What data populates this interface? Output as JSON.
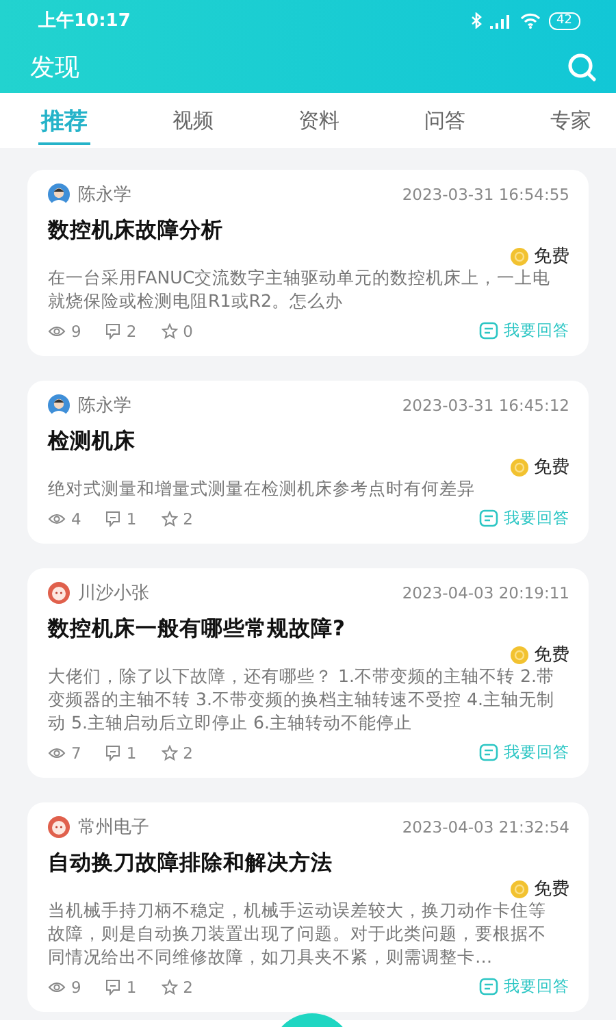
{
  "status_bar": {
    "time": "上午10:17",
    "battery": "42"
  },
  "header": {
    "title": "发现"
  },
  "tabs": [
    {
      "label": "推荐",
      "selected": true
    },
    {
      "label": "视频",
      "selected": false
    },
    {
      "label": "资料",
      "selected": false
    },
    {
      "label": "问答",
      "selected": false
    },
    {
      "label": "专家",
      "selected": false
    }
  ],
  "posts": [
    {
      "kind": "person",
      "author": "陈永学",
      "time": "2023-03-31 16:54:55",
      "title": "数控机床故障分析",
      "price": "免费",
      "description": "在一台采用FANUC交流数字主轴驱动单元的数控机床上，一上电就烧保险或检测电阻R1或R2。怎么办",
      "views": "9",
      "comments": "2",
      "favorites": "0",
      "answer": "我要回答"
    },
    {
      "kind": "person",
      "author": "陈永学",
      "time": "2023-03-31 16:45:12",
      "title": "检测机床",
      "price": "免费",
      "description": "绝对式测量和增量式测量在检测机床参考点时有何差异",
      "views": "4",
      "comments": "1",
      "favorites": "2",
      "answer": "我要回答"
    },
    {
      "kind": "face",
      "author": "川沙小张",
      "time": "2023-04-03 20:19:11",
      "title": "数控机床一般有哪些常规故障?",
      "price": "免费",
      "description": "大佬们，除了以下故障，还有哪些？ 1.不带变频的主轴不转 2.带变频器的主轴不转 3.不带变频的换档主轴转速不受控 4.主轴无制动 5.主轴启动后立即停止 6.主轴转动不能停止",
      "views": "7",
      "comments": "1",
      "favorites": "2",
      "answer": "我要回答"
    },
    {
      "kind": "face",
      "author": "常州电子",
      "time": "2023-04-03 21:32:54",
      "title": "自动换刀故障排除和解决方法",
      "price": "免费",
      "description": "当机械手持刀柄不稳定，机械手运动误差较大，换刀动作卡住等故障，则是自动换刀装置出现了问题。对于此类问题，要根据不同情况给出不同维修故障，如刀具夹不紧，则需调整卡…",
      "views": "9",
      "comments": "1",
      "favorites": "2",
      "answer": "我要回答"
    }
  ]
}
